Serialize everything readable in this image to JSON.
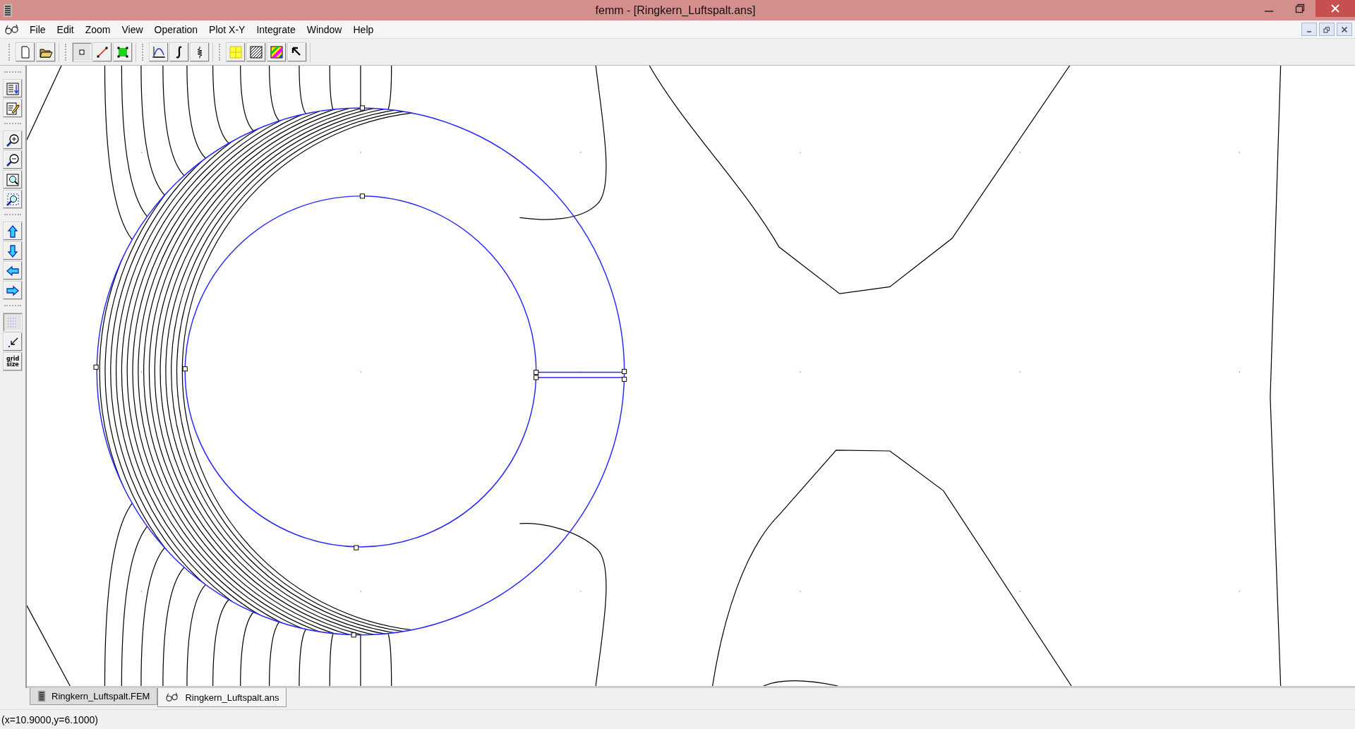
{
  "window": {
    "title": "femm - [Ringkern_Luftspalt.ans]"
  },
  "menu": [
    {
      "label": "File"
    },
    {
      "label": "Edit"
    },
    {
      "label": "Zoom"
    },
    {
      "label": "View"
    },
    {
      "label": "Operation"
    },
    {
      "label": "Plot X-Y"
    },
    {
      "label": "Integrate"
    },
    {
      "label": "Window"
    },
    {
      "label": "Help"
    }
  ],
  "toolbar": [
    [
      {
        "kind": "new",
        "pressed": false
      },
      {
        "kind": "open",
        "pressed": false
      }
    ],
    [
      {
        "kind": "node",
        "pressed": true
      },
      {
        "kind": "segment",
        "pressed": false
      },
      {
        "kind": "block",
        "pressed": false
      }
    ],
    [
      {
        "kind": "plot",
        "pressed": false
      },
      {
        "kind": "integral",
        "pressed": false
      },
      {
        "kind": "circuit",
        "pressed": false
      }
    ],
    [
      {
        "kind": "contour",
        "pressed": false
      },
      {
        "kind": "density",
        "pressed": false
      },
      {
        "kind": "colors",
        "pressed": false
      },
      {
        "kind": "pointer",
        "pressed": false
      }
    ]
  ],
  "side_toolbar": [
    [
      {
        "kind": "report",
        "pressed": false
      },
      {
        "kind": "edit",
        "pressed": false
      }
    ],
    [
      {
        "kind": "zoom-in",
        "pressed": false
      },
      {
        "kind": "zoom-out",
        "pressed": false
      },
      {
        "kind": "zoom-natural",
        "pressed": false
      },
      {
        "kind": "zoom-window",
        "pressed": false
      }
    ],
    [
      {
        "kind": "up",
        "pressed": false
      },
      {
        "kind": "down",
        "pressed": false
      },
      {
        "kind": "left",
        "pressed": false
      },
      {
        "kind": "right",
        "pressed": false
      }
    ],
    [
      {
        "kind": "grid",
        "pressed": true
      },
      {
        "kind": "snap",
        "pressed": false
      },
      {
        "kind": "gridsize",
        "pressed": false,
        "label": "grid size"
      }
    ]
  ],
  "tabs": [
    {
      "label": "Ringkern_Luftspalt.FEM",
      "kind": "fem",
      "selected": false
    },
    {
      "label": "Ringkern_Luftspalt.ans",
      "kind": "ans",
      "selected": true
    }
  ],
  "status_bar": "(x=10.9000,y=6.1000)"
}
